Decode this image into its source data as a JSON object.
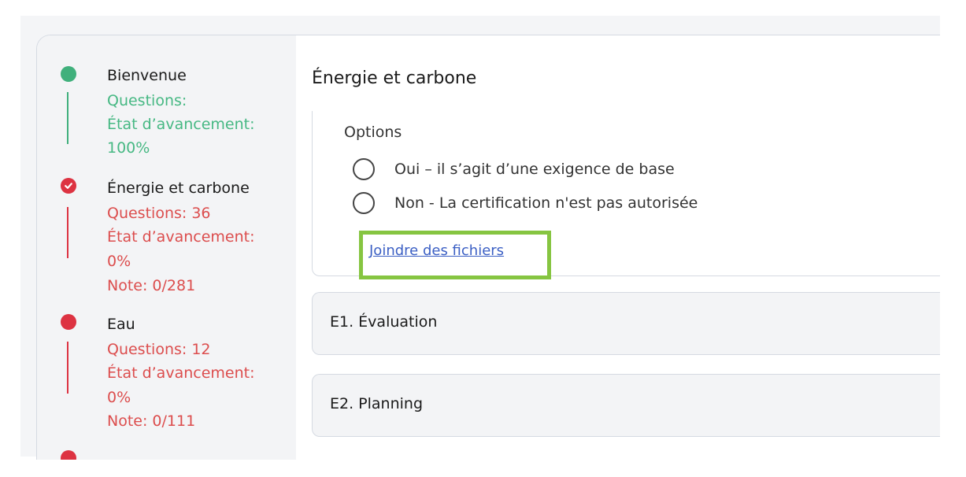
{
  "sidebar": {
    "steps": [
      {
        "title": "Bienvenue",
        "lines": [
          "Questions:",
          "État d’avancement:",
          "100%"
        ],
        "status_color": "#40b07c",
        "icon": "dot"
      },
      {
        "title": "Énergie et carbone",
        "lines": [
          "Questions: 36",
          "État d’avancement:",
          "0%",
          "Note: 0/281"
        ],
        "status_color": "#dd3342",
        "icon": "check"
      },
      {
        "title": "Eau",
        "lines": [
          "Questions: 12",
          "État d’avancement:",
          "0%",
          "Note: 0/111"
        ],
        "status_color": "#dd3342",
        "icon": "dot"
      }
    ]
  },
  "main": {
    "section_title": "Énergie et carbone",
    "options_label": "Options",
    "options": [
      "Oui – il s’agit d’une exigence de base",
      "Non - La certification n'est pas autorisée"
    ],
    "attach_link": "Joindre des fichiers",
    "highlight_color": "#86c541",
    "accordions": [
      "E1. Évaluation",
      "E2. Planning"
    ]
  }
}
